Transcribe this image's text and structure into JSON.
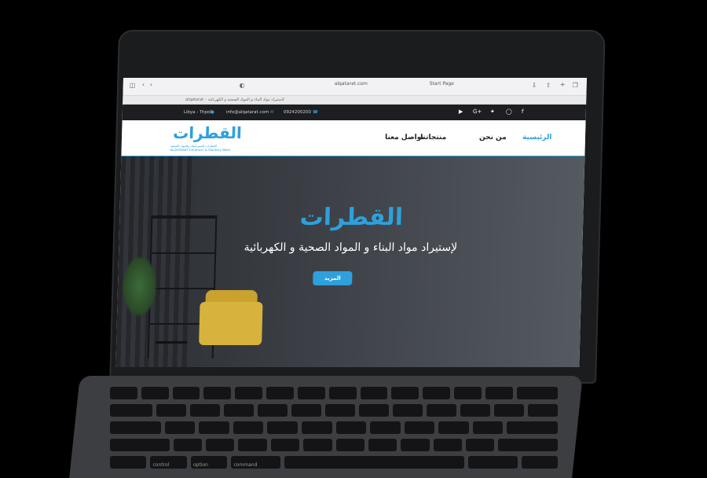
{
  "browser": {
    "url": "alqatarat.com",
    "start_page": "Start Page",
    "tab_title": "alqatarat – لاستيراد مواد البناء و المواد الصحية و الكهربائية"
  },
  "topbar": {
    "location": "Libya - Tripoli",
    "email": "info@alqatarat.com",
    "phone": "0924200200"
  },
  "social": [
    "youtube-icon",
    "google-plus-icon",
    "twitter-icon",
    "instagram-icon",
    "facebook-icon"
  ],
  "logo": {
    "arabic": "القطرات",
    "sub_ar": "القطرات للسيراميك والمواد الصحية",
    "sub_en": "ALQATARAT Ceramics & Sanitary Ware"
  },
  "nav": {
    "home": "الرئيسية",
    "about": "من نحن",
    "products": "منتجاتنا",
    "contact": "تواصل معنا"
  },
  "hero": {
    "title": "القطرات",
    "subtitle": "لإستيراد مواد البناء و المواد الصحية و الكهربائية",
    "button": "المزيد"
  },
  "keyboard": {
    "control": "control",
    "option": "option",
    "command": "command"
  },
  "colors": {
    "accent": "#2ea0dc",
    "topbar": "#1d1e21"
  }
}
